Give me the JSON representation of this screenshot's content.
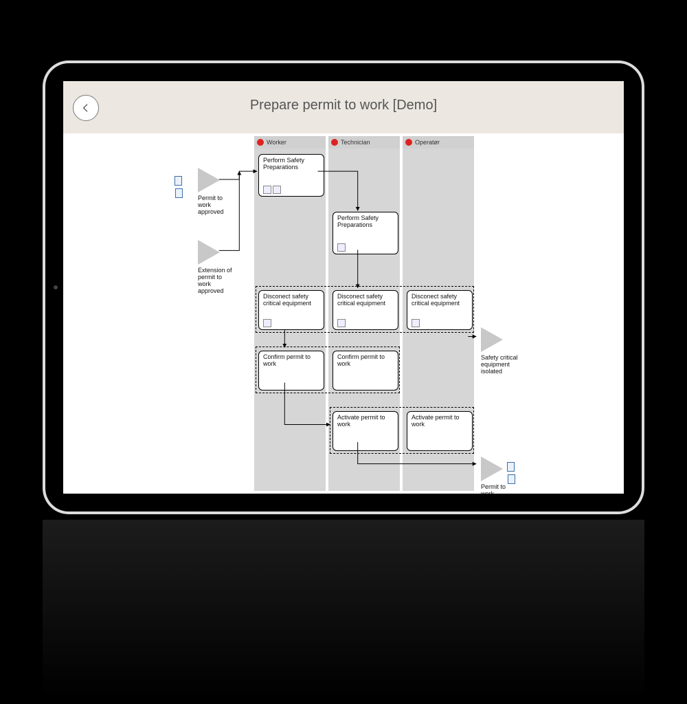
{
  "header": {
    "title": "Prepare permit to work [Demo]"
  },
  "lanes": {
    "worker": "Worker",
    "technician": "Technician",
    "operator": "Operatør"
  },
  "events": {
    "in1": "Permit to work approved",
    "in2": "Extension of permit to work approved",
    "out1": "Safety critical equipment isolated",
    "out2": "Permit to work activated"
  },
  "nodes": {
    "n_w_psp": "Perform Safety Preparations",
    "n_t_psp": "Perform Safety Preparations",
    "n_w_dsc": "Disconect safety critical equipment",
    "n_t_dsc": "Disconect safety critical equipment",
    "n_o_dsc": "Disconect safety critical equipment",
    "n_w_cpw": "Confirm permit to work",
    "n_t_cpw": "Confirm permit to work",
    "n_t_apw": "Activate permit to work",
    "n_o_apw": "Activate permit to work"
  }
}
